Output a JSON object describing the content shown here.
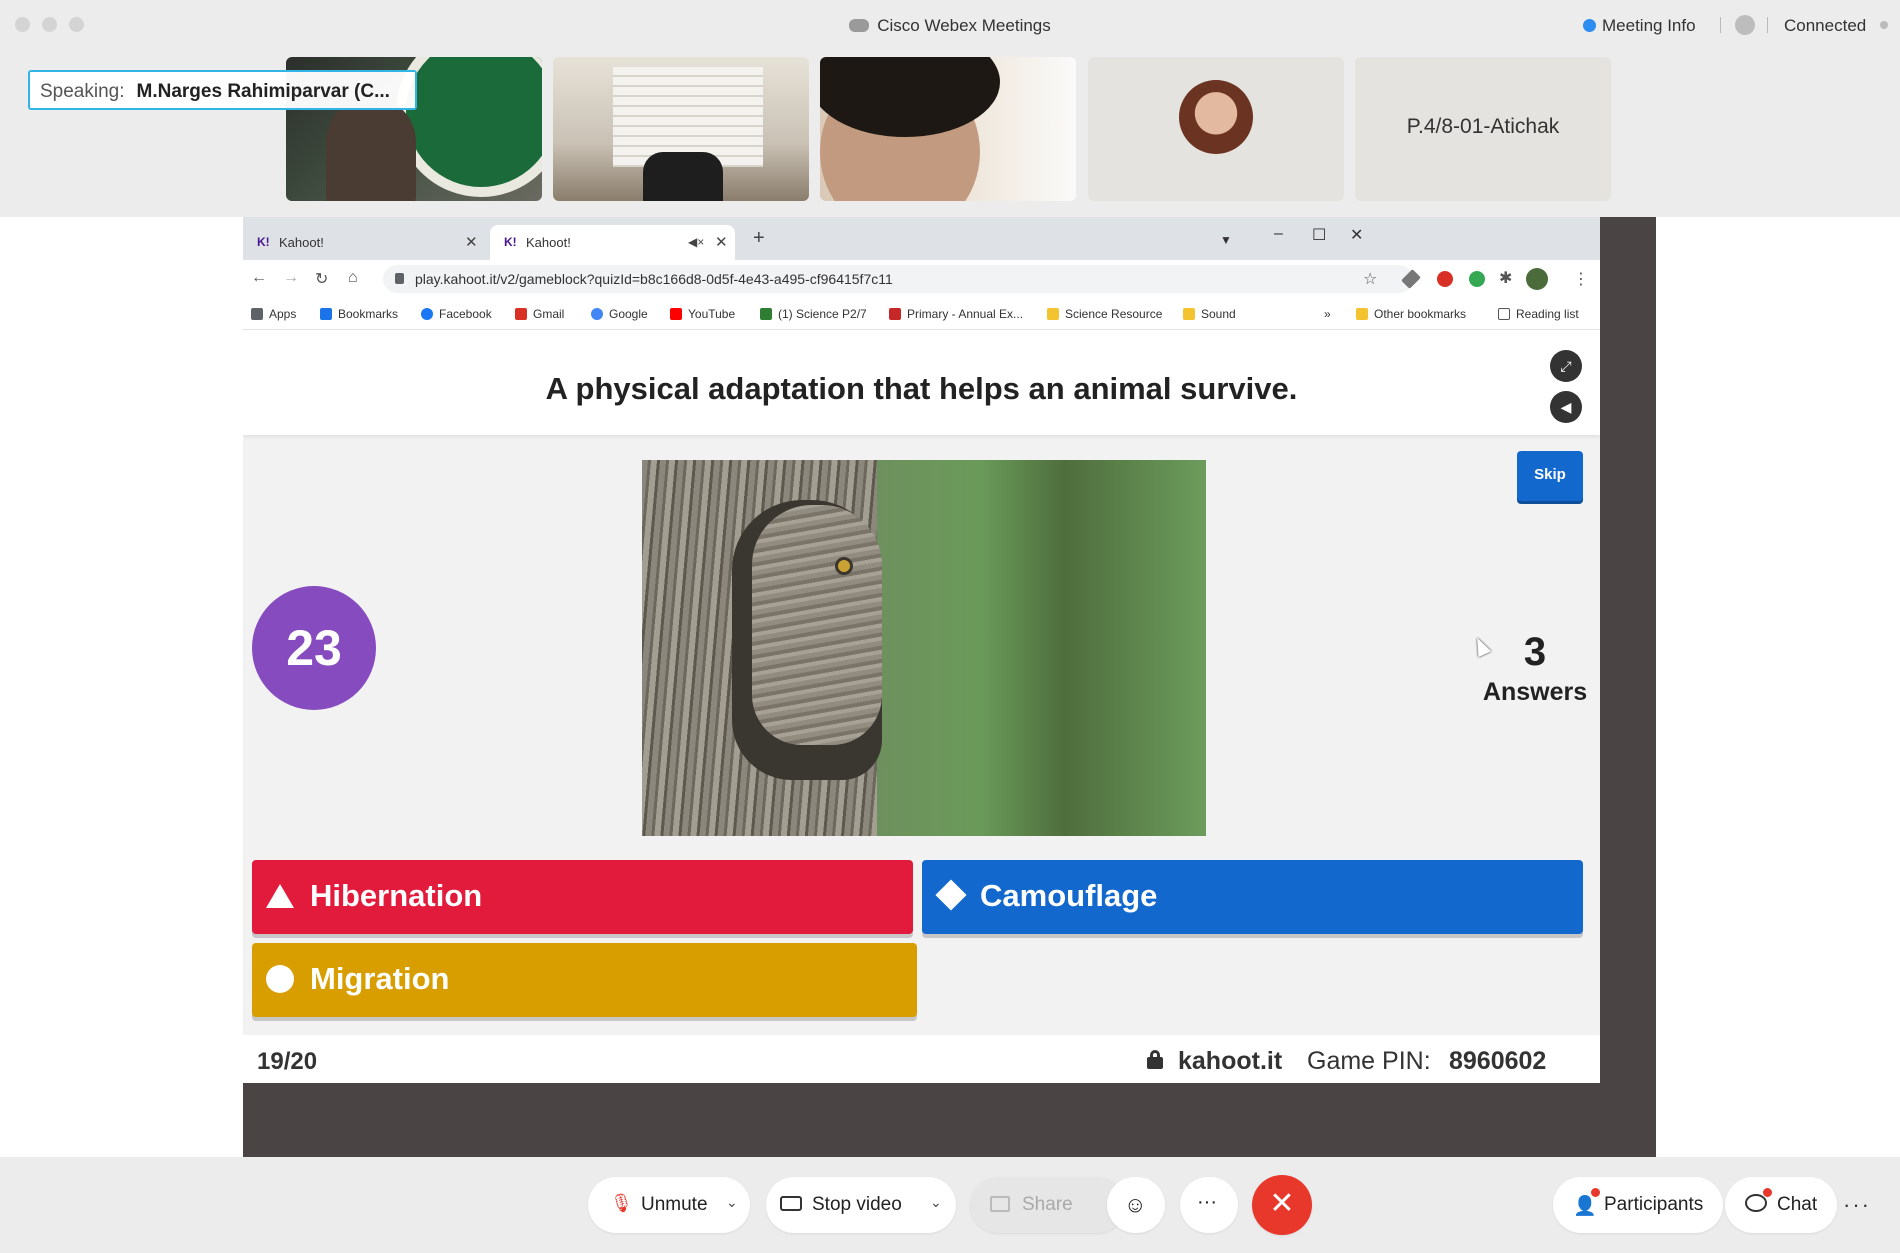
{
  "window": {
    "app_title": "Cisco Webex Meetings",
    "meeting_info": "Meeting Info",
    "connection_status": "Connected"
  },
  "participants": {
    "speaking_label": "Speaking:",
    "speaking_name": "M.Narges Rahimiparvar (C...",
    "tile_name": "P.4/8-01-Atichak"
  },
  "browser": {
    "tabs": [
      {
        "label": "Kahoot!",
        "favicon": "K!"
      },
      {
        "label": "Kahoot!",
        "favicon": "K!"
      }
    ],
    "url": "play.kahoot.it/v2/gameblock?quizId=b8c166d8-0d5f-4e43-a495-cf96415f7c11",
    "bookmarks": [
      {
        "label": "Apps",
        "color": "#5f6368"
      },
      {
        "label": "Bookmarks",
        "color": "#1a73e8"
      },
      {
        "label": "Facebook",
        "color": "#1877f2"
      },
      {
        "label": "Gmail",
        "color": "#d93025"
      },
      {
        "label": "Google",
        "color": "#4285f4"
      },
      {
        "label": "YouTube",
        "color": "#ff0000"
      },
      {
        "label": "(1) Science P2/7",
        "color": "#2e7d32"
      },
      {
        "label": "Primary - Annual Ex...",
        "color": "#c62828"
      },
      {
        "label": "Science Resource",
        "color": "#f4c430"
      },
      {
        "label": "Sound",
        "color": "#f4c430"
      }
    ],
    "overflow": "»",
    "other_bookmarks": "Other bookmarks",
    "reading_list": "Reading list"
  },
  "kahoot": {
    "question": "A physical adaptation that helps an animal survive.",
    "skip_label": "Skip",
    "timer": "23",
    "answers_count": "3",
    "answers_label": "Answers",
    "options": [
      {
        "label": "Hibernation",
        "shape": "triangle",
        "color": "#e21b3c"
      },
      {
        "label": "Camouflage",
        "shape": "diamond",
        "color": "#1368ce"
      },
      {
        "label": "Migration",
        "shape": "circle",
        "color": "#d89e00"
      }
    ],
    "progress": "19/20",
    "site": "kahoot.it",
    "pin_label": "Game PIN:",
    "pin_value": "8960602"
  },
  "controls": {
    "unmute": "Unmute",
    "stop_video": "Stop video",
    "share": "Share",
    "participants": "Participants",
    "chat": "Chat"
  },
  "colors": {
    "leave_button": "#e8372b",
    "speaking_border": "#32b5e6",
    "timer": "#864cbf"
  }
}
